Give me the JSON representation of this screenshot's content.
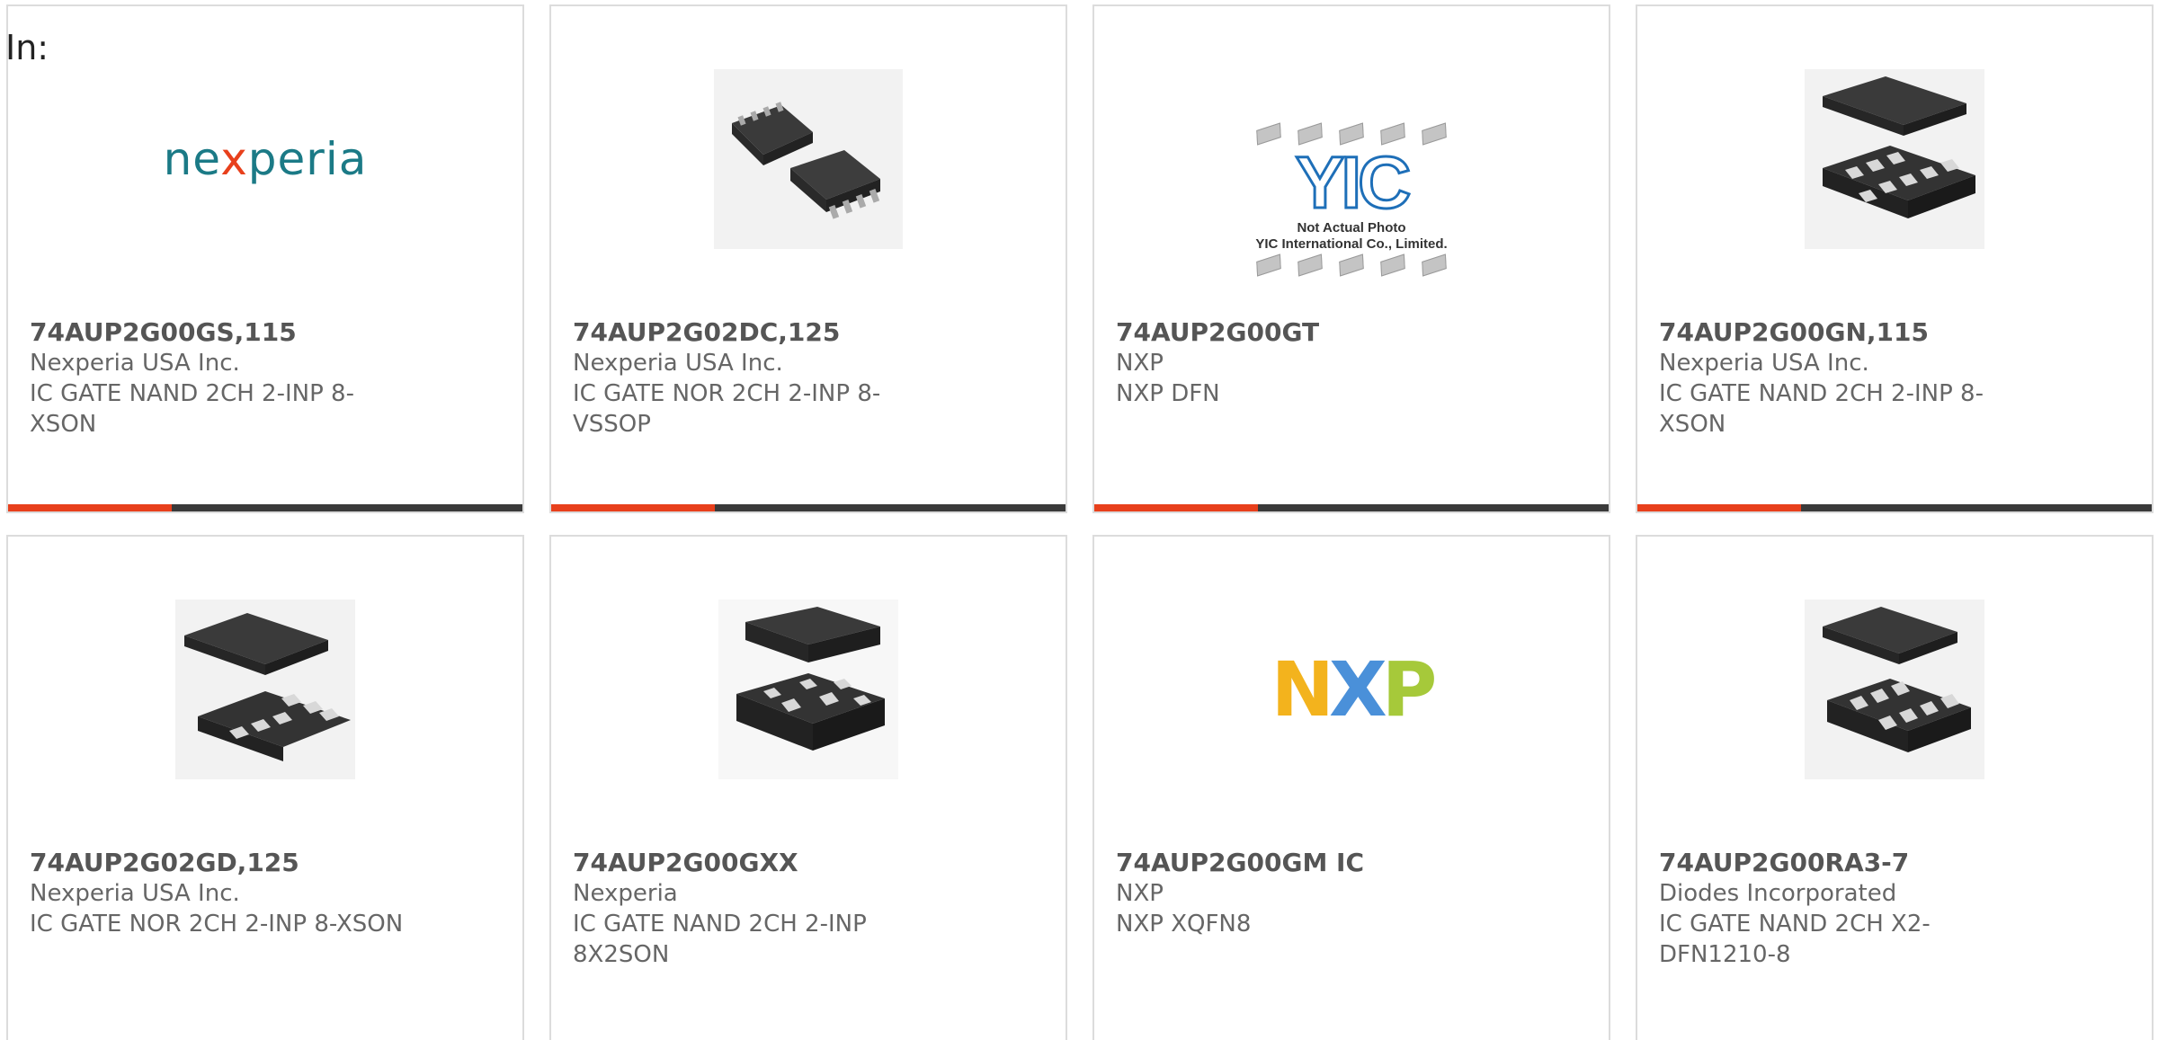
{
  "header": {
    "in_label": "In:"
  },
  "products": [
    {
      "part_number": "74AUP2G00GS,115",
      "manufacturer": "Nexperia USA Inc.",
      "description": "IC GATE NAND 2CH 2-INP 8-XSON",
      "image": "nexperia-logo"
    },
    {
      "part_number": "74AUP2G02DC,125",
      "manufacturer": "Nexperia USA Inc.",
      "description": "IC GATE NOR 2CH 2-INP 8-VSSOP",
      "image": "vssop-package-photo"
    },
    {
      "part_number": "74AUP2G00GT",
      "manufacturer": "NXP",
      "description": "NXP DFN",
      "image": "yic-placeholder-photo",
      "placeholder_line1": "Not Actual Photo",
      "placeholder_line2": "YIC International Co., Limited.",
      "placeholder_mark": "YIC"
    },
    {
      "part_number": "74AUP2G00GN,115",
      "manufacturer": "Nexperia USA Inc.",
      "description": "IC GATE NAND 2CH 2-INP 8-XSON",
      "image": "xson-package-photo"
    },
    {
      "part_number": "74AUP2G02GD,125",
      "manufacturer": "Nexperia USA Inc.",
      "description": "IC GATE NOR 2CH 2-INP 8-XSON",
      "image": "xson-package-photo"
    },
    {
      "part_number": "74AUP2G00GXX",
      "manufacturer": "Nexperia",
      "description": "IC GATE NAND 2CH 2-INP 8X2SON",
      "image": "x2son-package-photo"
    },
    {
      "part_number": "74AUP2G00GM IC",
      "manufacturer": "NXP",
      "description": "NXP XQFN8",
      "image": "nxp-logo"
    },
    {
      "part_number": "74AUP2G00RA3-7",
      "manufacturer": "Diodes Incorporated",
      "description": "IC GATE NAND 2CH X2-DFN1210-8",
      "image": "dfn-package-photo"
    }
  ],
  "logos": {
    "nexperia_pre": "ne",
    "nexperia_x": "x",
    "nexperia_post": "peria",
    "nxp_n": "N",
    "nxp_x": "X",
    "nxp_p": "P"
  },
  "colors": {
    "accent": "#e8401c",
    "bar": "#3a3a3a",
    "border": "#dcdcdc"
  }
}
